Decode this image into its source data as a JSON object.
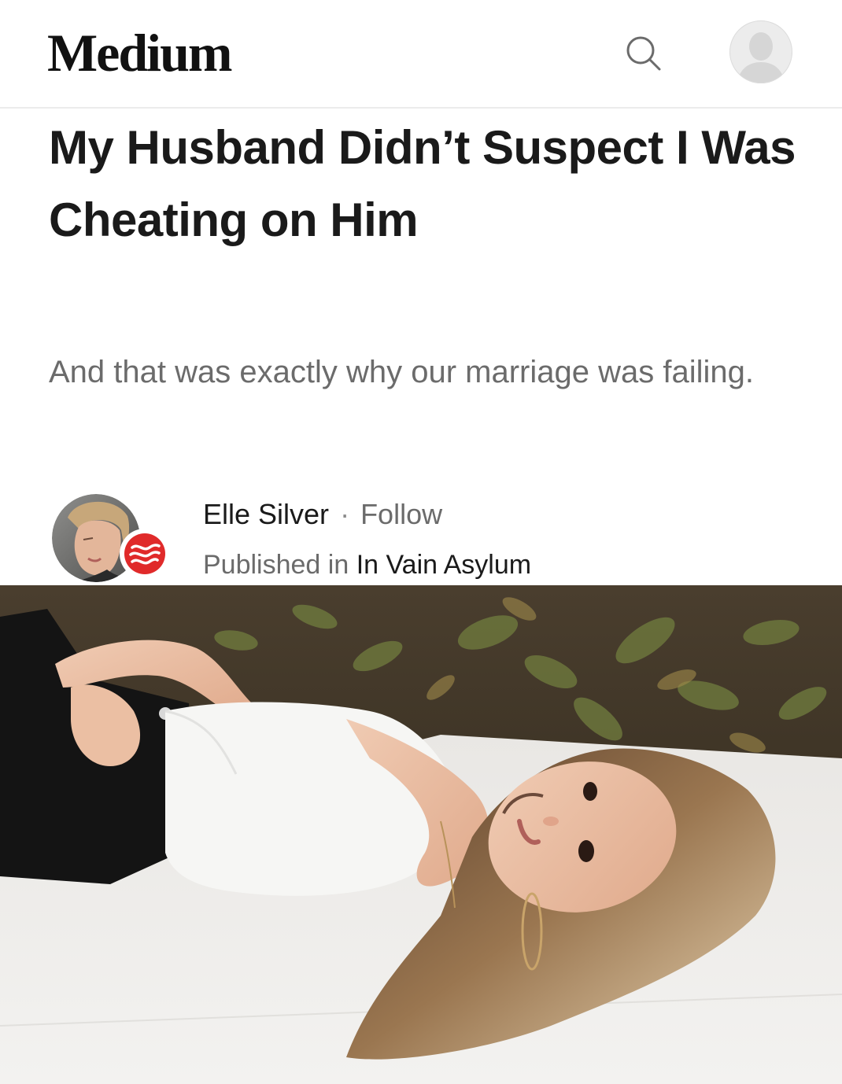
{
  "header": {
    "logo_text": "Medium",
    "search_icon": "search-icon",
    "avatar_icon": "user-avatar-icon"
  },
  "article": {
    "title": "My Husband Didn’t Suspect I Was Cheating on Him",
    "subtitle": "And that was exactly why our marriage was failing."
  },
  "author": {
    "name": "Elle Silver",
    "separator": "·",
    "follow_label": "Follow",
    "published_prefix": "Published in",
    "publication": "In Vain Asylum"
  },
  "colors": {
    "text_primary": "#1a1a1a",
    "text_secondary": "#6b6b6b",
    "publication_badge": "#e02a2a"
  }
}
